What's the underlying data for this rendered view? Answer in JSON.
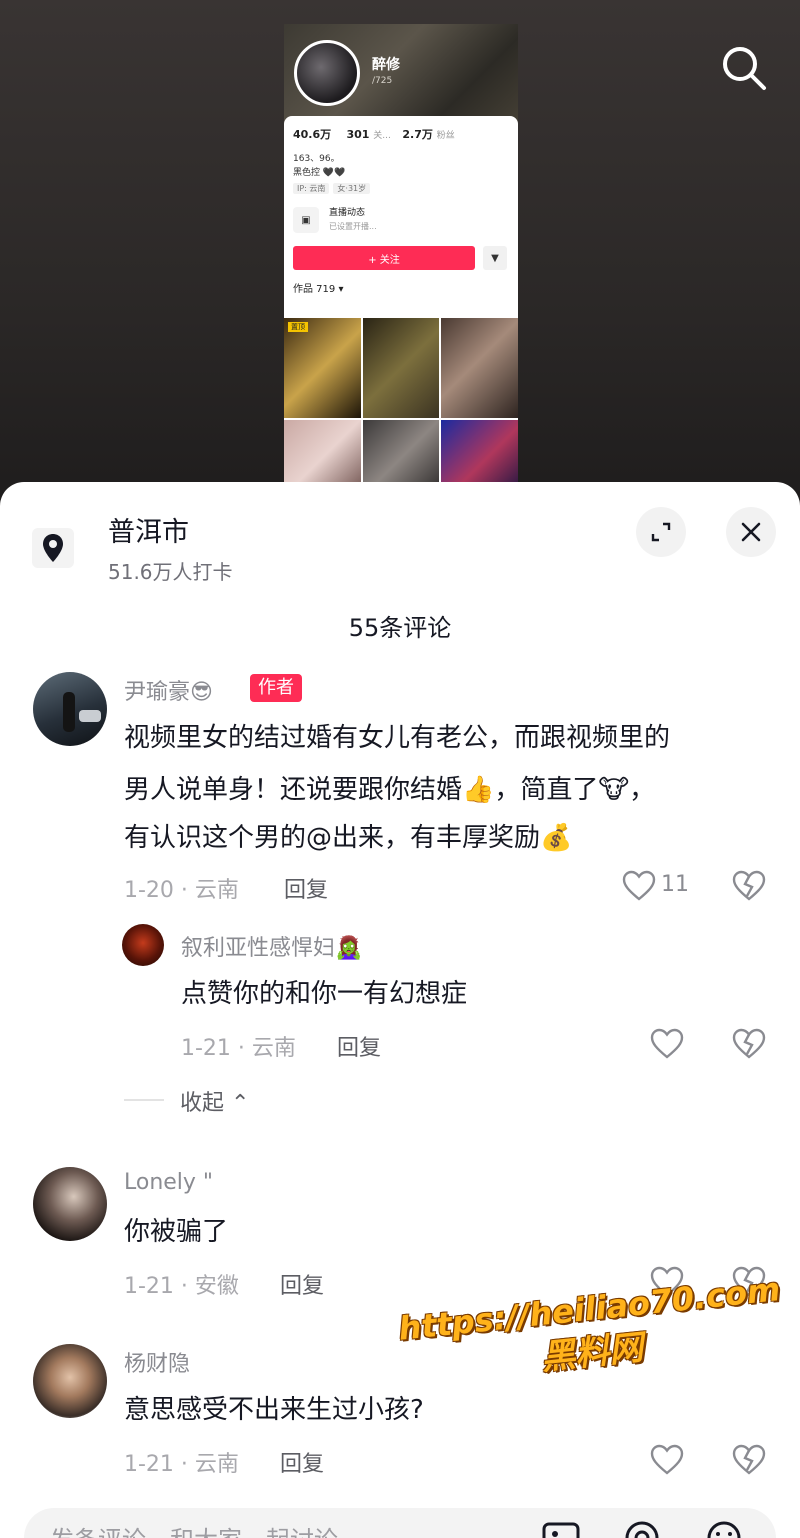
{
  "video": {
    "profile": {
      "name": "醉修",
      "id_text": "/725",
      "stats": {
        "likes": "40.6万",
        "following": "301",
        "following_label": "关...",
        "followers": "2.7万",
        "followers_label": "粉丝"
      },
      "bio_line1": "163、96。",
      "bio_line2": "黑色控 🖤🖤",
      "tags": [
        "IP: 云南",
        "女·31岁"
      ],
      "live_title": "直播动态",
      "live_sub": "已设置开播...",
      "follow_label": "+ 关注",
      "works_label": "作品 719 ▾",
      "pin_label": "置顶"
    }
  },
  "sheet": {
    "location": {
      "name": "普洱市",
      "checkins": "51.6万人打卡"
    },
    "count_title": "55条评论"
  },
  "comments": [
    {
      "user": "尹瑜豪😎",
      "badge": "作者",
      "lines": [
        "视频里女的结过婚有女儿有老公，而跟视频里的",
        "男人说单身！还说要跟你结婚👍，简直了🐮，",
        "有认识这个男的@出来，有丰厚奖励💰"
      ],
      "meta": "1-20 · 云南",
      "reply": "回复",
      "likes": "11"
    },
    {
      "user": "叙利亚性感悍妇🧟‍♀️",
      "lines": [
        "点赞你的和你一有幻想症"
      ],
      "meta": "1-21 · 云南",
      "reply": "回复"
    },
    {
      "user": "Lonely \"",
      "lines": [
        "你被骗了"
      ],
      "meta": "1-21 · 安徽",
      "reply": "回复"
    },
    {
      "user": "杨财隐",
      "lines": [
        "意思感受不出来生过小孩?"
      ],
      "meta": "1-21 · 云南",
      "reply": "回复"
    }
  ],
  "collapse_label": "收起 ⌃",
  "watermark": {
    "url": "https://heiliao70.com",
    "name": "黑料网"
  },
  "input": {
    "placeholder": "发条评论，和大家一起讨论"
  }
}
